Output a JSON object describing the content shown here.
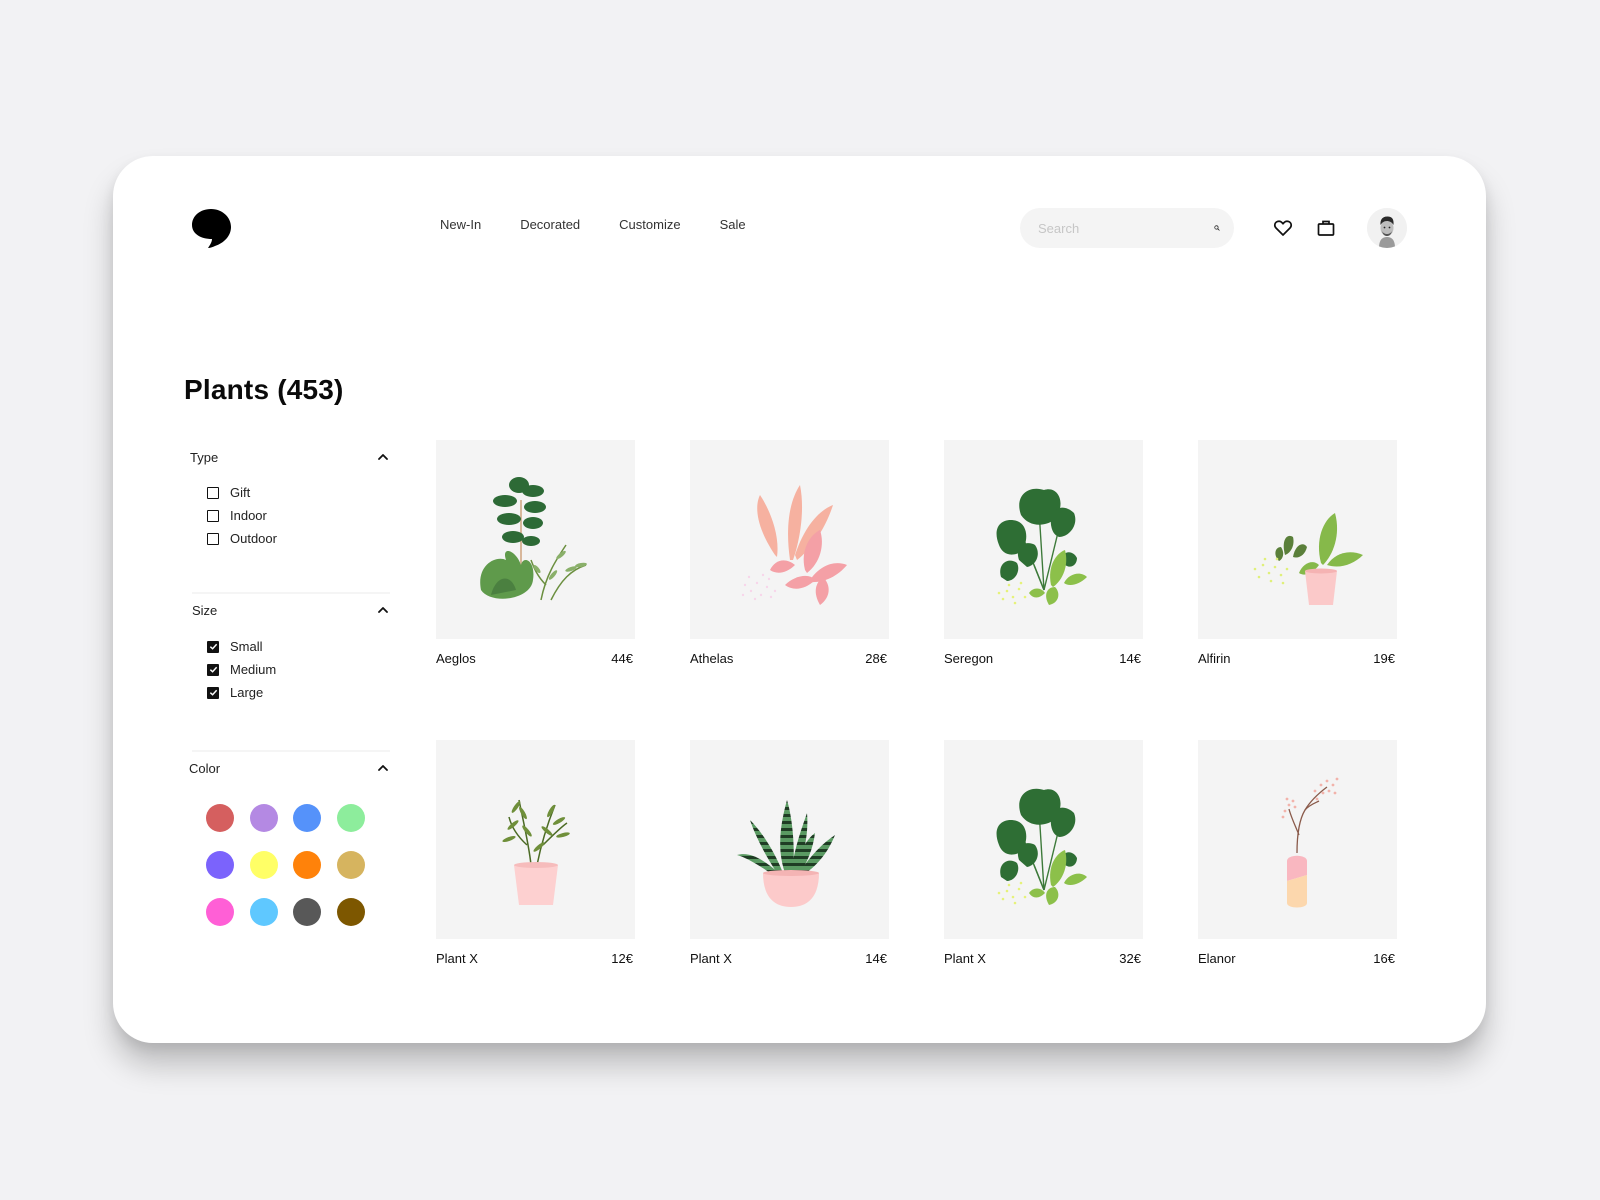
{
  "header": {
    "logo_icon": "comma-logo-icon",
    "nav": [
      {
        "label": "New-In"
      },
      {
        "label": "Decorated"
      },
      {
        "label": "Customize"
      },
      {
        "label": "Sale"
      }
    ],
    "search": {
      "placeholder": "Search",
      "value": "",
      "icon": "search-icon"
    },
    "wishlist_icon": "heart-icon",
    "cart_icon": "shopping-bag-icon",
    "avatar_icon": "user-avatar"
  },
  "page": {
    "title": "Plants (453)"
  },
  "filters": {
    "type": {
      "label": "Type",
      "expanded": true,
      "options": [
        {
          "label": "Gift",
          "checked": false
        },
        {
          "label": "Indoor",
          "checked": false
        },
        {
          "label": "Outdoor",
          "checked": false
        }
      ]
    },
    "size": {
      "label": "Size",
      "expanded": true,
      "options": [
        {
          "label": "Small",
          "checked": true
        },
        {
          "label": "Medium",
          "checked": true
        },
        {
          "label": "Large",
          "checked": true
        }
      ]
    },
    "color": {
      "label": "Color",
      "expanded": true,
      "swatches": [
        "#d55f5f",
        "#b489e3",
        "#5592fa",
        "#8ded9c",
        "#7b63fc",
        "#ffff66",
        "#ff820a",
        "#d6b45f",
        "#ff5fd6",
        "#5fc8ff",
        "#585858",
        "#7d5700"
      ]
    }
  },
  "products": [
    {
      "name": "Aeglos",
      "price": "44€",
      "illustration": "leafy-green-plants"
    },
    {
      "name": "Athelas",
      "price": "28€",
      "illustration": "pink-leaf-plant"
    },
    {
      "name": "Seregon",
      "price": "14€",
      "illustration": "monstera-plant"
    },
    {
      "name": "Alfirin",
      "price": "19€",
      "illustration": "potted-dieffenbachia"
    },
    {
      "name": "Plant X",
      "price": "12€",
      "illustration": "potted-herb"
    },
    {
      "name": "Plant X",
      "price": "14€",
      "illustration": "potted-snake-plant"
    },
    {
      "name": "Plant X",
      "price": "32€",
      "illustration": "monstera-plant"
    },
    {
      "name": "Elanor",
      "price": "16€",
      "illustration": "blossom-branch-vase"
    }
  ]
}
